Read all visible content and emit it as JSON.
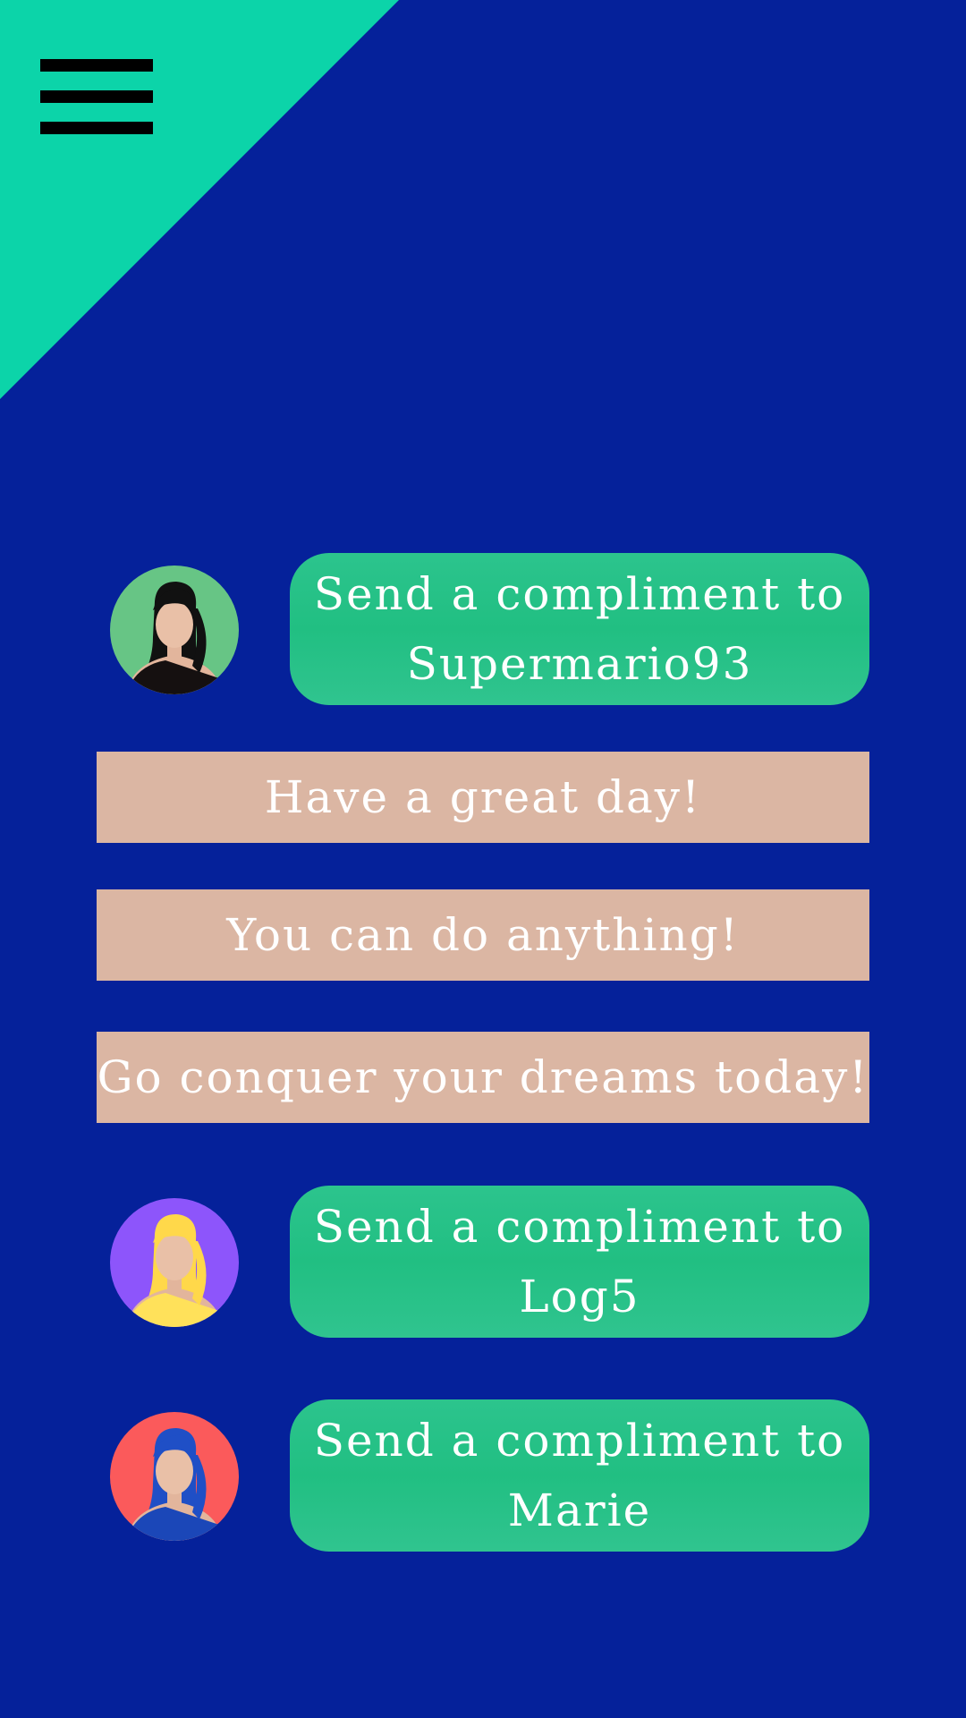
{
  "menu": {
    "icon": "hamburger-menu-icon"
  },
  "colors": {
    "background": "#05219a",
    "corner_accent": "#0cd4a9",
    "compliment_button": "#22c085",
    "message_option": "#dbb6a3",
    "text": "#ffffff"
  },
  "users": [
    {
      "avatar_icon": "avatar-woman-black-hair-icon",
      "button_line1": "Send a compliment to",
      "button_line2": "Supermario93"
    },
    {
      "avatar_icon": "avatar-woman-blonde-hair-icon",
      "button_line1": "Send a compliment to",
      "button_line2": "Log5"
    },
    {
      "avatar_icon": "avatar-woman-blue-hair-icon",
      "button_line1": "Send a compliment to",
      "button_line2": "Marie"
    }
  ],
  "messages": [
    "Have a great day!",
    "You can do anything!",
    "Go conquer your dreams today!"
  ]
}
